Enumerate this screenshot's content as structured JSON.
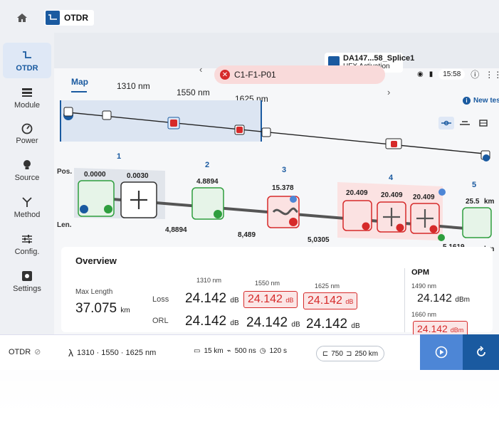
{
  "app": {
    "title": "OTDR"
  },
  "device": {
    "name": "DA147...58_Splice1",
    "subtitle": "HFX Activation",
    "time": "15:58"
  },
  "rail": [
    {
      "label": "OTDR",
      "icon": "otdr-trace-icon"
    },
    {
      "label": "Module",
      "icon": "module-icon"
    },
    {
      "label": "Power",
      "icon": "gauge-icon"
    },
    {
      "label": "Source",
      "icon": "bulb-icon"
    },
    {
      "label": "Method",
      "icon": "method-icon"
    },
    {
      "label": "Config.",
      "icon": "sliders-icon"
    },
    {
      "label": "Settings",
      "icon": "settings-icon"
    }
  ],
  "fiber": {
    "label": "C1-F1-P01",
    "status_color": "#d62a2a"
  },
  "tabs": [
    "Map",
    "1310 nm",
    "1550 nm",
    "1625 nm"
  ],
  "new_test": "New test",
  "map": {
    "pos_label": "Pos.",
    "len_label": "Len.",
    "events": [
      {
        "num": "1",
        "positions": [
          "0.0000",
          "0.0030"
        ]
      },
      {
        "num": "2",
        "positions": [
          "4.8894"
        ]
      },
      {
        "num": "3",
        "positions": [
          "15.378"
        ]
      },
      {
        "num": "4",
        "positions": [
          "20.409",
          "20.409",
          "20.409"
        ]
      },
      {
        "num": "5",
        "positions": [
          "25.5"
        ]
      }
    ],
    "lengths": [
      "4,8894",
      "8,489",
      "5,0305",
      "5,1619"
    ],
    "unit": "km"
  },
  "overview": {
    "title": "Overview",
    "max_length_label": "Max Length",
    "max_length": "37.075",
    "max_length_unit": "km",
    "wavelengths": [
      "1310 nm",
      "1550 nm",
      "1625 nm"
    ],
    "loss_label": "Loss",
    "orl_label": "ORL",
    "loss": [
      "24.142",
      "24.142",
      "24.142"
    ],
    "orl": [
      "24.142",
      "24.142",
      "24.142"
    ],
    "db": "dB",
    "opm": {
      "title": "OPM",
      "w1": "1490 nm",
      "v1": "24.142",
      "w2": "1660 nm",
      "v2": "24.142",
      "unit": "dBm"
    }
  },
  "bottom": {
    "mode": "OTDR",
    "wavelengths": "1310 · 1550 · 1625 nm",
    "range": "15 km",
    "pulse": "500 ns",
    "duration": "120 s",
    "fiber_range": "750",
    "fiber_end": "250 km"
  }
}
